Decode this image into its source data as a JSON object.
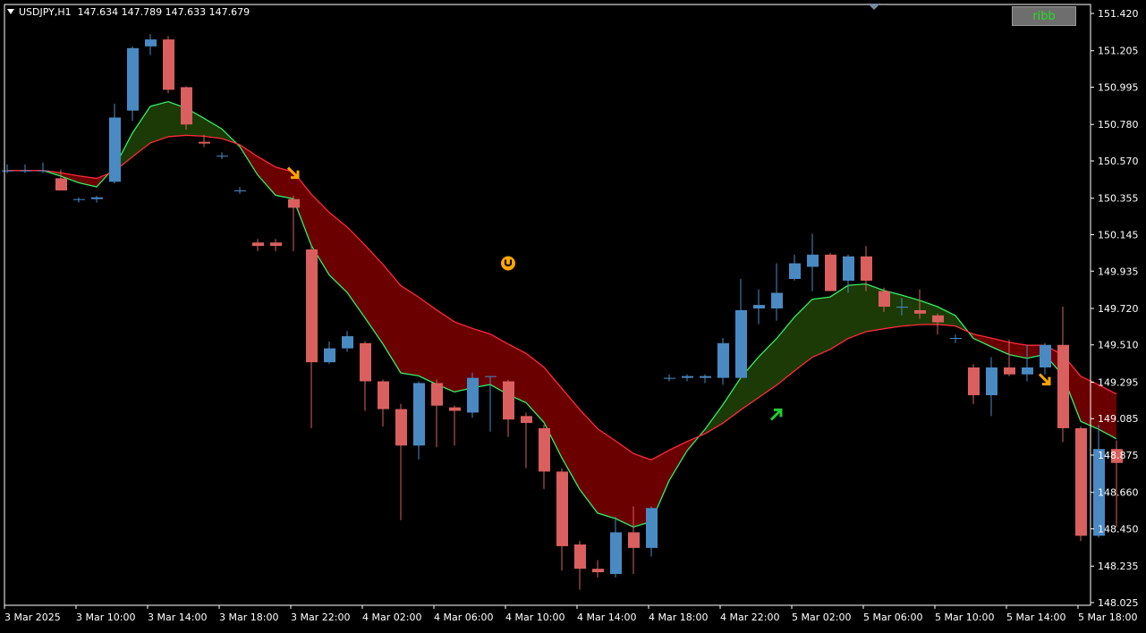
{
  "header": {
    "symbol": "USDJPY,H1",
    "ohlc": "147.634 147.789 147.633 147.679"
  },
  "button": {
    "label": "ribb"
  },
  "colors": {
    "background": "#000000",
    "axis": "#ffffff",
    "bull": "#4a8ac3",
    "bear": "#d9605f",
    "ribbon_up": "#2b6a00",
    "ribbon_up_dark": "#1c3a05",
    "ribbon_down": "#6a0000",
    "ribbon_down_dark": "#3a0000",
    "line_up": "#33ee66",
    "line_down": "#ff2a3a",
    "arrow_orange": "#ffa500",
    "arrow_green": "#22cc33"
  },
  "chart_data": {
    "type": "candlestick",
    "symbol": "USDJPY",
    "timeframe": "H1",
    "y_ticks": [
      "151.420",
      "151.205",
      "150.995",
      "150.780",
      "150.570",
      "150.355",
      "150.145",
      "149.935",
      "149.720",
      "149.510",
      "149.295",
      "149.085",
      "148.875",
      "148.660",
      "148.450",
      "148.235",
      "148.025"
    ],
    "x_ticks": [
      "3 Mar 2025",
      "3 Mar 10:00",
      "3 Mar 14:00",
      "3 Mar 18:00",
      "3 Mar 22:00",
      "4 Mar 02:00",
      "4 Mar 06:00",
      "4 Mar 10:00",
      "4 Mar 14:00",
      "4 Mar 18:00",
      "4 Mar 22:00",
      "5 Mar 02:00",
      "5 Mar 06:00",
      "5 Mar 10:00",
      "5 Mar 14:00",
      "5 Mar 18:00"
    ],
    "ylim": [
      148.0,
      151.44
    ],
    "candles": [
      {
        "o": 150.515,
        "h": 150.55,
        "l": 150.5,
        "c": 150.515
      },
      {
        "o": 150.515,
        "h": 150.55,
        "l": 150.5,
        "c": 150.515
      },
      {
        "o": 150.515,
        "h": 150.56,
        "l": 150.5,
        "c": 150.515
      },
      {
        "o": 150.47,
        "h": 150.52,
        "l": 150.4,
        "c": 150.4
      },
      {
        "o": 150.35,
        "h": 150.36,
        "l": 150.33,
        "c": 150.35
      },
      {
        "o": 150.35,
        "h": 150.37,
        "l": 150.33,
        "c": 150.36
      },
      {
        "o": 150.45,
        "h": 150.9,
        "l": 150.44,
        "c": 150.82
      },
      {
        "o": 150.86,
        "h": 151.23,
        "l": 150.8,
        "c": 151.22
      },
      {
        "o": 151.23,
        "h": 151.3,
        "l": 151.18,
        "c": 151.27
      },
      {
        "o": 151.27,
        "h": 151.29,
        "l": 150.96,
        "c": 150.98
      },
      {
        "o": 150.995,
        "h": 151.0,
        "l": 150.75,
        "c": 150.78
      },
      {
        "o": 150.68,
        "h": 150.72,
        "l": 150.65,
        "c": 150.67
      },
      {
        "o": 150.6,
        "h": 150.62,
        "l": 150.58,
        "c": 150.6
      },
      {
        "o": 150.4,
        "h": 150.42,
        "l": 150.38,
        "c": 150.4
      },
      {
        "o": 150.1,
        "h": 150.12,
        "l": 150.05,
        "c": 150.08
      },
      {
        "o": 150.1,
        "h": 150.12,
        "l": 150.05,
        "c": 150.08
      },
      {
        "o": 150.35,
        "h": 150.37,
        "l": 150.05,
        "c": 150.3
      },
      {
        "o": 150.06,
        "h": 150.08,
        "l": 149.03,
        "c": 149.41
      },
      {
        "o": 149.41,
        "h": 149.53,
        "l": 149.4,
        "c": 149.49
      },
      {
        "o": 149.49,
        "h": 149.59,
        "l": 149.47,
        "c": 149.56
      },
      {
        "o": 149.52,
        "h": 149.53,
        "l": 149.13,
        "c": 149.3
      },
      {
        "o": 149.3,
        "h": 149.31,
        "l": 149.04,
        "c": 149.14
      },
      {
        "o": 149.14,
        "h": 149.17,
        "l": 148.5,
        "c": 148.93
      },
      {
        "o": 148.93,
        "h": 149.3,
        "l": 148.85,
        "c": 149.29
      },
      {
        "o": 149.29,
        "h": 149.31,
        "l": 148.92,
        "c": 149.16
      },
      {
        "o": 149.15,
        "h": 149.16,
        "l": 148.93,
        "c": 149.13
      },
      {
        "o": 149.12,
        "h": 149.35,
        "l": 149.09,
        "c": 149.32
      },
      {
        "o": 149.33,
        "h": 149.33,
        "l": 149.01,
        "c": 149.33
      },
      {
        "o": 149.3,
        "h": 149.31,
        "l": 148.98,
        "c": 149.08
      },
      {
        "o": 149.1,
        "h": 149.12,
        "l": 148.8,
        "c": 149.06
      },
      {
        "o": 149.03,
        "h": 149.05,
        "l": 148.68,
        "c": 148.78
      },
      {
        "o": 148.78,
        "h": 148.8,
        "l": 148.21,
        "c": 148.35
      },
      {
        "o": 148.36,
        "h": 148.38,
        "l": 148.1,
        "c": 148.22
      },
      {
        "o": 148.22,
        "h": 148.27,
        "l": 148.17,
        "c": 148.2
      },
      {
        "o": 148.19,
        "h": 148.52,
        "l": 148.17,
        "c": 148.43
      },
      {
        "o": 148.43,
        "h": 148.58,
        "l": 148.19,
        "c": 148.34
      },
      {
        "o": 148.34,
        "h": 148.58,
        "l": 148.29,
        "c": 148.57
      },
      {
        "o": 149.32,
        "h": 149.34,
        "l": 149.3,
        "c": 149.32
      },
      {
        "o": 149.32,
        "h": 149.34,
        "l": 149.3,
        "c": 149.33
      },
      {
        "o": 149.32,
        "h": 149.34,
        "l": 149.29,
        "c": 149.33
      },
      {
        "o": 149.32,
        "h": 149.55,
        "l": 149.28,
        "c": 149.52
      },
      {
        "o": 149.32,
        "h": 149.89,
        "l": 149.32,
        "c": 149.71
      },
      {
        "o": 149.72,
        "h": 149.83,
        "l": 149.63,
        "c": 149.74
      },
      {
        "o": 149.72,
        "h": 149.98,
        "l": 149.65,
        "c": 149.81
      },
      {
        "o": 149.89,
        "h": 150.03,
        "l": 149.88,
        "c": 149.98
      },
      {
        "o": 149.96,
        "h": 150.15,
        "l": 149.82,
        "c": 150.03
      },
      {
        "o": 150.03,
        "h": 150.04,
        "l": 149.82,
        "c": 149.82
      },
      {
        "o": 149.88,
        "h": 150.03,
        "l": 149.81,
        "c": 150.02
      },
      {
        "o": 150.02,
        "h": 150.08,
        "l": 149.82,
        "c": 149.88
      },
      {
        "o": 149.82,
        "h": 149.84,
        "l": 149.7,
        "c": 149.73
      },
      {
        "o": 149.73,
        "h": 149.78,
        "l": 149.68,
        "c": 149.73
      },
      {
        "o": 149.71,
        "h": 149.83,
        "l": 149.66,
        "c": 149.69
      },
      {
        "o": 149.68,
        "h": 149.69,
        "l": 149.57,
        "c": 149.64
      },
      {
        "o": 149.55,
        "h": 149.57,
        "l": 149.52,
        "c": 149.55
      },
      {
        "o": 149.38,
        "h": 149.4,
        "l": 149.17,
        "c": 149.22
      },
      {
        "o": 149.22,
        "h": 149.44,
        "l": 149.1,
        "c": 149.38
      },
      {
        "o": 149.38,
        "h": 149.54,
        "l": 149.33,
        "c": 149.34
      },
      {
        "o": 149.34,
        "h": 149.51,
        "l": 149.3,
        "c": 149.38
      },
      {
        "o": 149.38,
        "h": 149.52,
        "l": 149.34,
        "c": 149.51
      },
      {
        "o": 149.51,
        "h": 149.73,
        "l": 148.95,
        "c": 149.03
      },
      {
        "o": 149.03,
        "h": 149.04,
        "l": 148.38,
        "c": 148.41
      },
      {
        "o": 148.41,
        "h": 149.05,
        "l": 148.4,
        "c": 148.91
      },
      {
        "o": 148.91,
        "h": 148.96,
        "l": 148.46,
        "c": 148.83
      }
    ],
    "signals": [
      {
        "type": "arrow-down",
        "color": "orange",
        "bar": 16,
        "price": 150.5
      },
      {
        "type": "hold",
        "color": "orange",
        "bar": 28,
        "price": 149.98
      },
      {
        "type": "arrow-up",
        "color": "green",
        "bar": 43,
        "price": 149.11
      },
      {
        "type": "arrow-down",
        "color": "orange",
        "bar": 58,
        "price": 149.31
      }
    ]
  }
}
